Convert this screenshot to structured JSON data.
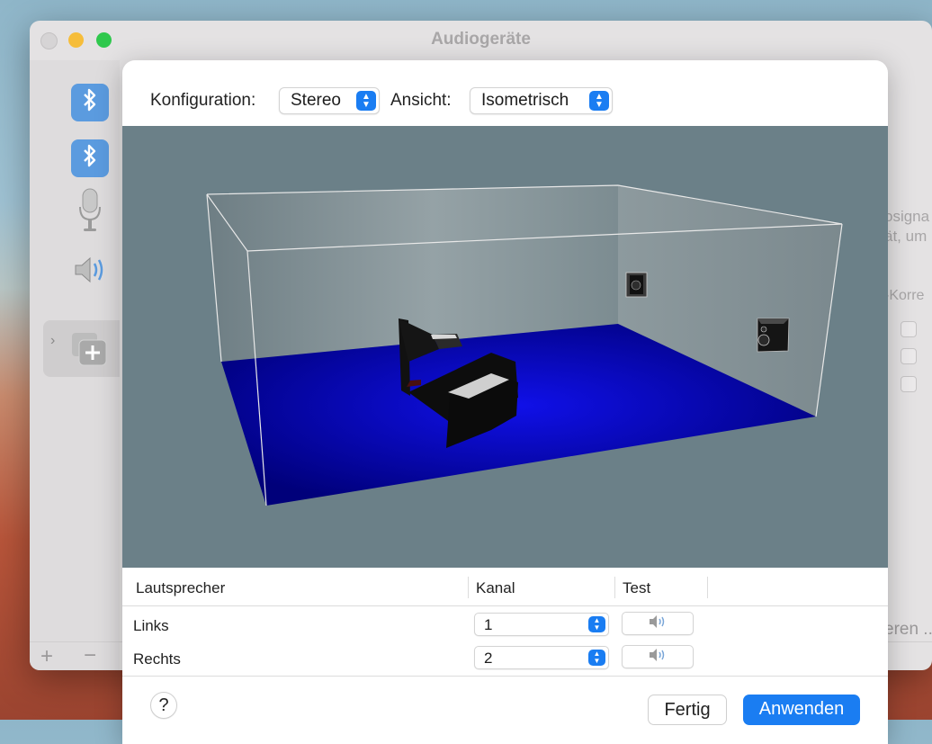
{
  "window": {
    "title": "Audiogeräte"
  },
  "background": {
    "right_text_1": "osigna",
    "right_text_2": "ät, um",
    "column_partial": "-Korre",
    "button_partial": "eren ..."
  },
  "toolbar": {
    "config_label": "Konfiguration:",
    "config_value": "Stereo",
    "view_label": "Ansicht:",
    "view_value": "Isometrisch"
  },
  "table": {
    "headers": [
      "Lautsprecher",
      "Kanal",
      "Test"
    ],
    "rows": [
      {
        "speaker": "Links",
        "channel": "1"
      },
      {
        "speaker": "Rechts",
        "channel": "2"
      }
    ]
  },
  "footer": {
    "help_label": "?",
    "done_label": "Fertig",
    "apply_label": "Anwenden"
  },
  "colors": {
    "accent": "#1a7df2",
    "floor": "#0000c8",
    "viewport_bg": "#6b8088"
  },
  "icons": [
    "bluetooth-icon",
    "microphone-icon",
    "speaker-icon",
    "add-aggregate-icon",
    "speaker-test-icon",
    "stepper-icon"
  ]
}
